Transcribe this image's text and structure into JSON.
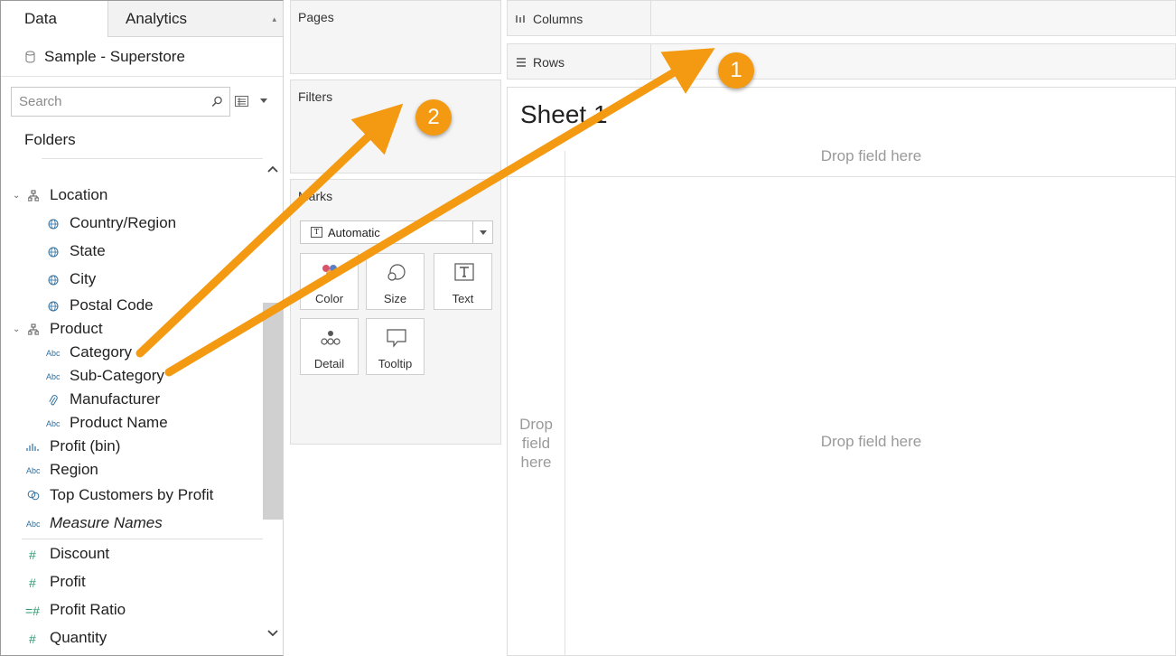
{
  "tabs": {
    "data": "Data",
    "analytics": "Analytics"
  },
  "datasource": {
    "name": "Sample - Superstore"
  },
  "search": {
    "placeholder": "Search"
  },
  "folders_label": "Folders",
  "fields": [
    {
      "label": "Location",
      "icon": "hierarchy-icon"
    },
    {
      "label": "Country/Region",
      "icon": "globe-icon"
    },
    {
      "label": "State",
      "icon": "globe-icon"
    },
    {
      "label": "City",
      "icon": "globe-icon"
    },
    {
      "label": "Postal Code",
      "icon": "globe-icon"
    },
    {
      "label": "Product",
      "icon": "hierarchy-icon"
    },
    {
      "label": "Category",
      "icon": "abc-icon"
    },
    {
      "label": "Sub-Category",
      "icon": "abc-icon"
    },
    {
      "label": "Manufacturer",
      "icon": "paperclip-icon"
    },
    {
      "label": "Product Name",
      "icon": "abc-icon"
    },
    {
      "label": "Profit (bin)",
      "icon": "bin-icon"
    },
    {
      "label": "Region",
      "icon": "abc-icon"
    },
    {
      "label": "Top Customers by Profit",
      "icon": "set-icon"
    },
    {
      "label": "Measure Names",
      "icon": "abc-icon"
    },
    {
      "label": "Discount",
      "icon": "hash-icon"
    },
    {
      "label": "Profit",
      "icon": "hash-icon"
    },
    {
      "label": "Profit Ratio",
      "icon": "calc-hash-icon"
    },
    {
      "label": "Quantity",
      "icon": "hash-icon"
    }
  ],
  "abc_icon_text": "Abc",
  "cards": {
    "pages": "Pages",
    "filters": "Filters",
    "marks": "Marks"
  },
  "marks": {
    "type": "Automatic",
    "buttons": {
      "color": "Color",
      "size": "Size",
      "text": "Text",
      "detail": "Detail",
      "tooltip": "Tooltip"
    }
  },
  "shelves": {
    "columns": "Columns",
    "rows": "Rows"
  },
  "view": {
    "sheet_title": "Sheet 1",
    "drop_columns": "Drop field here",
    "drop_rows": "Drop field here",
    "drop_main": "Drop field here"
  },
  "annotations": {
    "badge_1": "1",
    "badge_2": "2"
  },
  "colors": {
    "annotation_orange": "#f39a12",
    "field_icon_blue": "#2f6f9f",
    "measure_green": "#2f9a72"
  }
}
